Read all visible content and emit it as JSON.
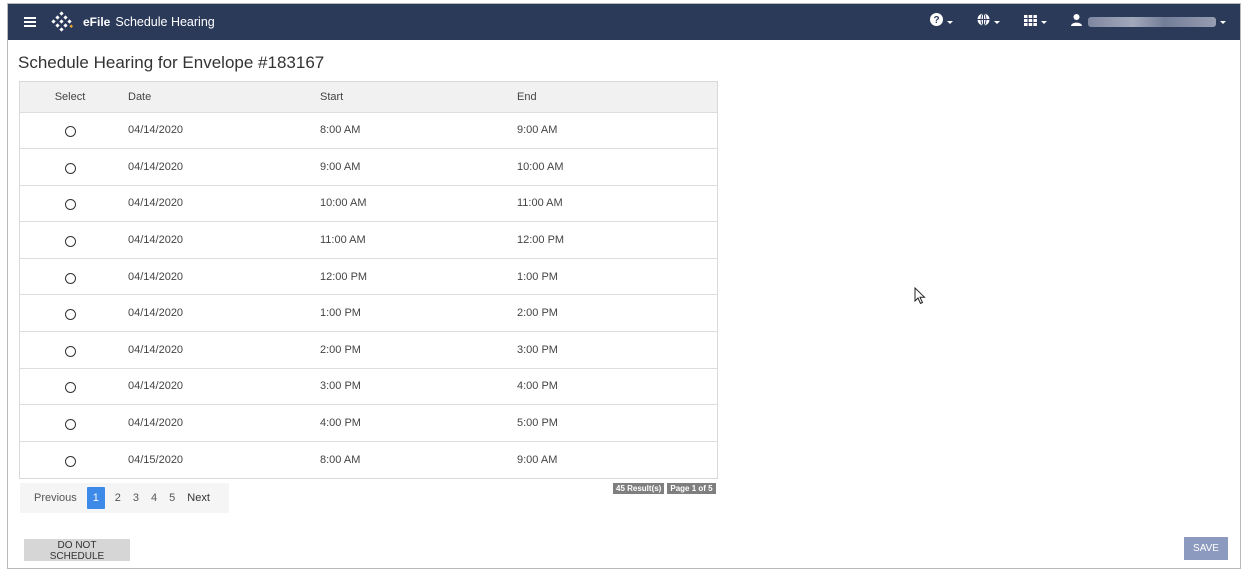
{
  "header": {
    "brand": "eFile",
    "page_name": "Schedule Hearing",
    "user_name_visible": false,
    "colors": {
      "background": "#2c3a5a",
      "text": "#ffffff"
    },
    "icons": [
      "menu-icon",
      "efile-logo",
      "help-icon",
      "globe-icon",
      "apps-grid-icon",
      "user-icon"
    ]
  },
  "page": {
    "title": "Schedule Hearing for Envelope #183167"
  },
  "table": {
    "columns": [
      "Select",
      "Date",
      "Start",
      "End"
    ],
    "rows": [
      {
        "date": "04/14/2020",
        "start": "8:00 AM",
        "end": "9:00 AM"
      },
      {
        "date": "04/14/2020",
        "start": "9:00 AM",
        "end": "10:00 AM"
      },
      {
        "date": "04/14/2020",
        "start": "10:00 AM",
        "end": "11:00 AM"
      },
      {
        "date": "04/14/2020",
        "start": "11:00 AM",
        "end": "12:00 PM"
      },
      {
        "date": "04/14/2020",
        "start": "12:00 PM",
        "end": "1:00 PM"
      },
      {
        "date": "04/14/2020",
        "start": "1:00 PM",
        "end": "2:00 PM"
      },
      {
        "date": "04/14/2020",
        "start": "2:00 PM",
        "end": "3:00 PM"
      },
      {
        "date": "04/14/2020",
        "start": "3:00 PM",
        "end": "4:00 PM"
      },
      {
        "date": "04/14/2020",
        "start": "4:00 PM",
        "end": "5:00 PM"
      },
      {
        "date": "04/15/2020",
        "start": "8:00 AM",
        "end": "9:00 AM"
      }
    ]
  },
  "pagination": {
    "previous": "Previous",
    "pages": [
      "1",
      "2",
      "3",
      "4",
      "5"
    ],
    "current": "1",
    "next": "Next",
    "results_badge": "45 Result(s)",
    "page_badge": "Page 1 of 5",
    "active_color": "#3e8ae9"
  },
  "actions": {
    "do_not_schedule": "DO NOT SCHEDULE",
    "save": "SAVE",
    "save_color": "#8d9abf"
  }
}
